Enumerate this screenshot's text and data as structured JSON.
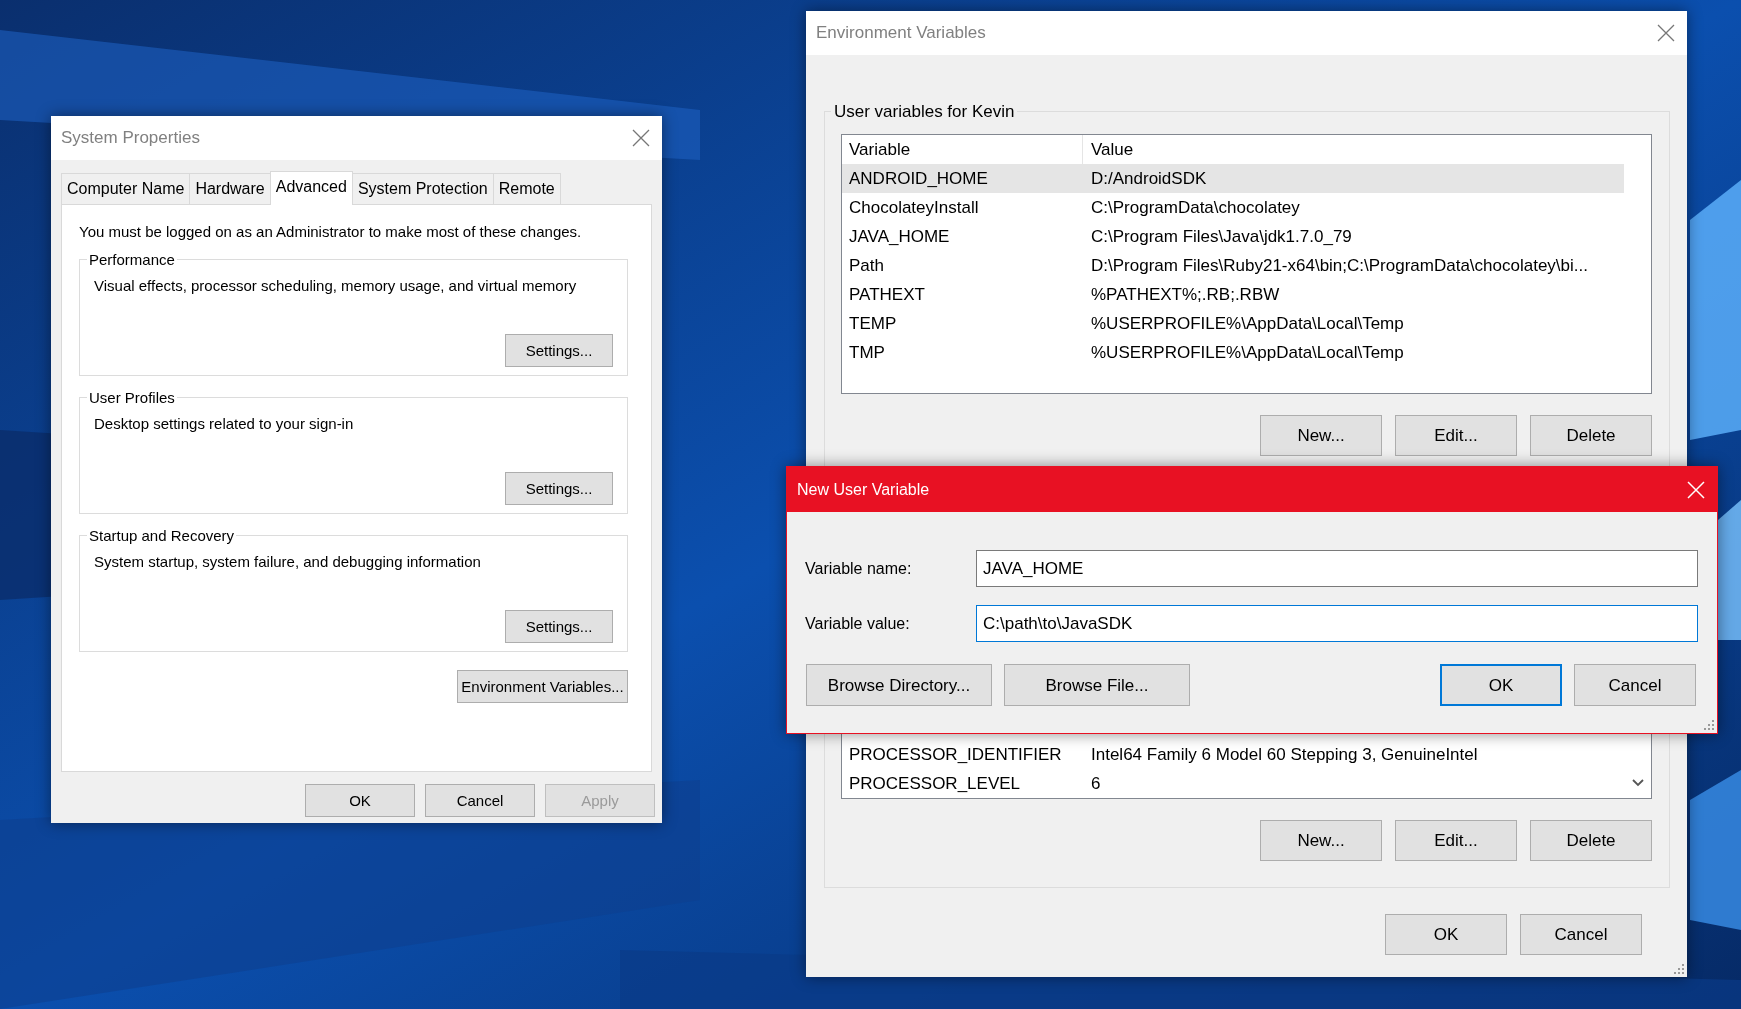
{
  "system_properties": {
    "title": "System Properties",
    "tabs": [
      {
        "label": "Computer Name",
        "selected": false
      },
      {
        "label": "Hardware",
        "selected": false
      },
      {
        "label": "Advanced",
        "selected": true
      },
      {
        "label": "System Protection",
        "selected": false
      },
      {
        "label": "Remote",
        "selected": false
      }
    ],
    "notice": "You must be logged on as an Administrator to make most of these changes.",
    "groups": [
      {
        "title": "Performance",
        "description": "Visual effects, processor scheduling, memory usage, and virtual memory",
        "button": "Settings..."
      },
      {
        "title": "User Profiles",
        "description": "Desktop settings related to your sign-in",
        "button": "Settings..."
      },
      {
        "title": "Startup and Recovery",
        "description": "System startup, system failure, and debugging information",
        "button": "Settings..."
      }
    ],
    "env_button": "Environment Variables...",
    "buttons": [
      {
        "label": "OK",
        "disabled": false
      },
      {
        "label": "Cancel",
        "disabled": false
      },
      {
        "label": "Apply",
        "disabled": true
      }
    ]
  },
  "environment_variables": {
    "title": "Environment Variables",
    "user_group": {
      "title": "User variables for Kevin",
      "columns": [
        "Variable",
        "Value"
      ],
      "rows": [
        {
          "variable": "ANDROID_HOME",
          "value": "D:/AndroidSDK",
          "selected": true
        },
        {
          "variable": "ChocolateyInstall",
          "value": "C:\\ProgramData\\chocolatey",
          "selected": false
        },
        {
          "variable": "JAVA_HOME",
          "value": "C:\\Program Files\\Java\\jdk1.7.0_79",
          "selected": false
        },
        {
          "variable": "Path",
          "value": "D:\\Program Files\\Ruby21-x64\\bin;C:\\ProgramData\\chocolatey\\bi...",
          "selected": false
        },
        {
          "variable": "PATHEXT",
          "value": "%PATHEXT%;.RB;.RBW",
          "selected": false
        },
        {
          "variable": "TEMP",
          "value": "%USERPROFILE%\\AppData\\Local\\Temp",
          "selected": false
        },
        {
          "variable": "TMP",
          "value": "%USERPROFILE%\\AppData\\Local\\Temp",
          "selected": false
        }
      ],
      "buttons": [
        "New...",
        "Edit...",
        "Delete"
      ]
    },
    "system_group": {
      "rows": [
        {
          "variable": "PROCESSOR_IDENTIFIER",
          "value": "Intel64 Family 6 Model 60 Stepping 3, GenuineIntel"
        },
        {
          "variable": "PROCESSOR_LEVEL",
          "value": "6"
        }
      ],
      "buttons": [
        "New...",
        "Edit...",
        "Delete"
      ]
    },
    "buttons": [
      "OK",
      "Cancel"
    ]
  },
  "new_user_variable": {
    "title": "New User Variable",
    "fields": [
      {
        "label": "Variable name:",
        "value": "JAVA_HOME",
        "focused": false
      },
      {
        "label": "Variable value:",
        "value": "C:\\path\\to\\JavaSDK",
        "focused": true
      }
    ],
    "browse_buttons": [
      "Browse Directory...",
      "Browse File..."
    ],
    "buttons": [
      {
        "label": "OK",
        "default": true
      },
      {
        "label": "Cancel",
        "default": false
      }
    ]
  }
}
